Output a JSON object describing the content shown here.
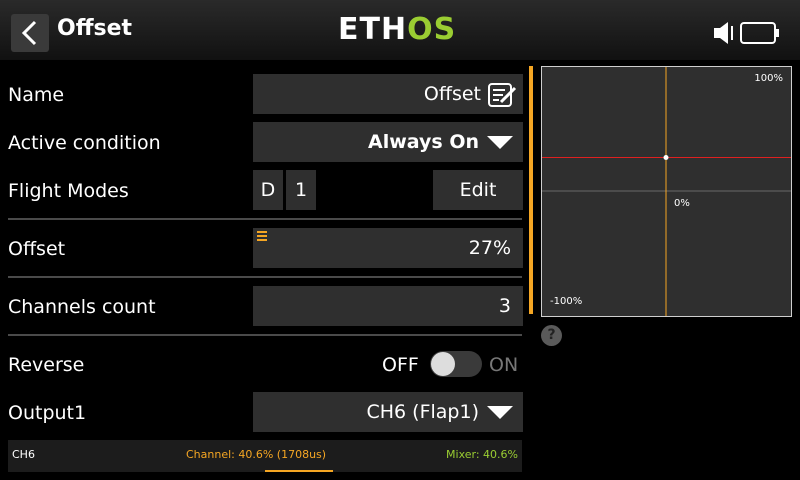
{
  "header": {
    "title": "Offset",
    "logo_part1": "ETH",
    "logo_part2": "OS"
  },
  "form": {
    "name": {
      "label": "Name",
      "value": "Offset"
    },
    "active_condition": {
      "label": "Active condition",
      "value": "Always On"
    },
    "flight_modes": {
      "label": "Flight Modes",
      "mode_d": "D",
      "mode_1": "1",
      "edit_label": "Edit"
    },
    "offset": {
      "label": "Offset",
      "value": "27%"
    },
    "channels_count": {
      "label": "Channels count",
      "value": "3"
    },
    "reverse": {
      "label": "Reverse",
      "off_label": "OFF",
      "on_label": "ON",
      "state": "off"
    },
    "output1": {
      "label": "Output1",
      "value": "CH6 (Flap1)"
    }
  },
  "status": {
    "channel_name": "CH6",
    "channel_text": "Channel: 40.6% (1708us)",
    "mixer_text": "Mixer: 40.6%",
    "channel_fraction": 0.406
  },
  "graph": {
    "top_label": "100%",
    "mid_label": "0%",
    "bottom_label": "-100%",
    "output_value_percent": 27,
    "help_label": "?"
  },
  "colors": {
    "accent": "#F5A623",
    "brand_green": "#9ACD32",
    "curve": "#E02020"
  }
}
